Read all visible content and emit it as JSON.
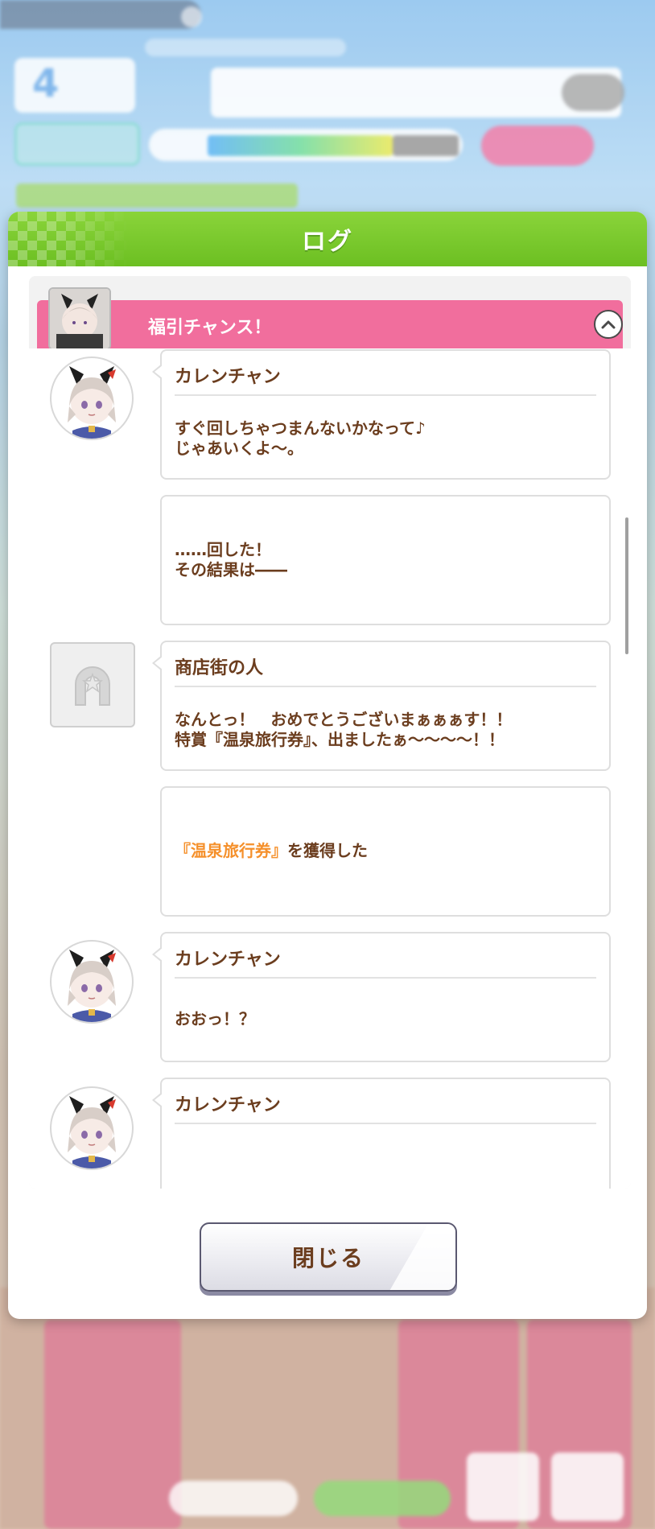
{
  "dialog": {
    "title": "ログ",
    "close_label": "閉じる"
  },
  "event": {
    "title": "福引チャンス！",
    "collapse_icon": "chevron-up-icon"
  },
  "entries": [
    {
      "type": "dialogue",
      "speaker": "カレンチャン",
      "message": "すぐ回しちゃつまんないかなって♪\nじゃあいくよ～。",
      "avatar": "karen-chan"
    },
    {
      "type": "narration",
      "message": "……回した！\nその結果は――"
    },
    {
      "type": "dialogue",
      "speaker": "商店街の人",
      "message": "なんとっ！　おめでとうございまぁぁぁす！！\n特賞『温泉旅行券』、出ましたぁ～～～～！！",
      "avatar": "generic-npc"
    },
    {
      "type": "narration",
      "item_open": "『",
      "item_name": "温泉旅行券",
      "item_close": "』",
      "message_suffix": "を獲得した"
    },
    {
      "type": "dialogue",
      "speaker": "カレンチャン",
      "message": "おおっ！？",
      "avatar": "karen-chan"
    },
    {
      "type": "dialogue",
      "speaker": "カレンチャン",
      "message": "",
      "avatar": "karen-chan"
    }
  ],
  "colors": {
    "header_green": "#7ccb2e",
    "event_pink": "#f16e9d",
    "text_brown": "#6b3d1e",
    "item_orange": "#f5902b"
  }
}
